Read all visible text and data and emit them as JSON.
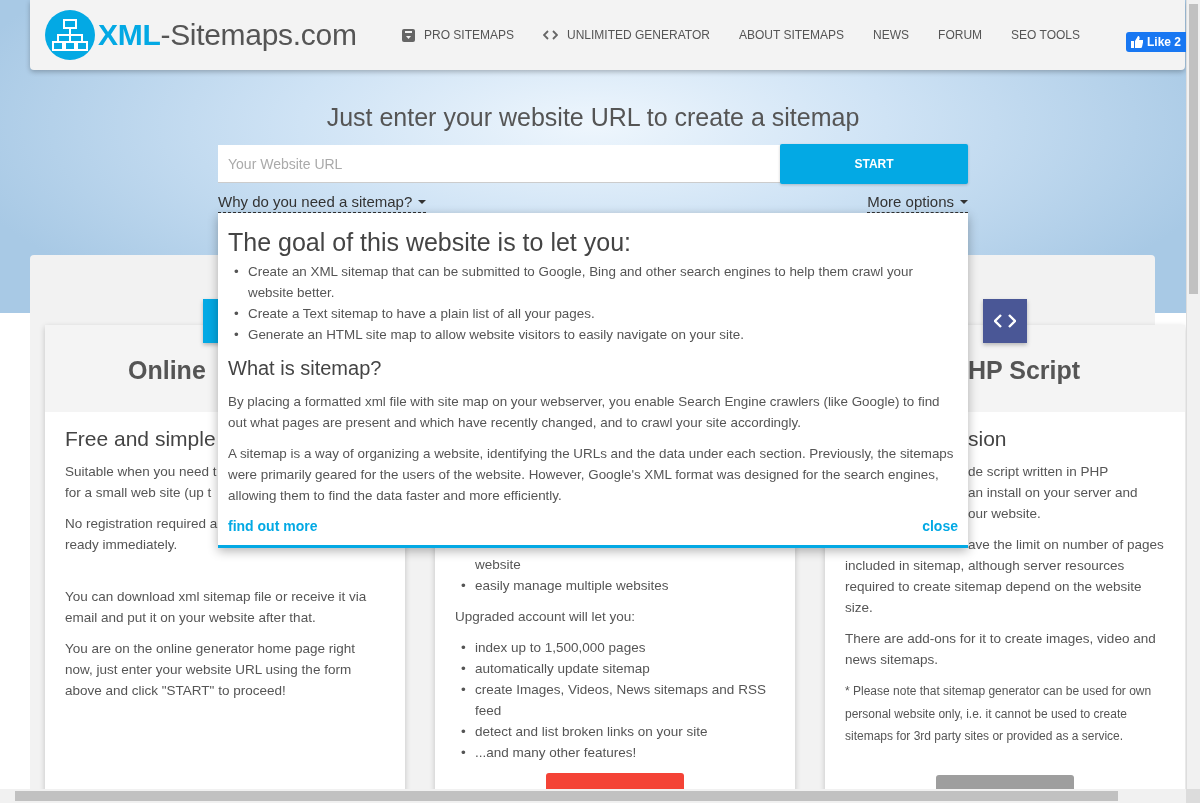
{
  "header": {
    "logo": "**XML**-Sitemaps.com",
    "nav": [
      {
        "label": "PRO SITEMAPS",
        "kind": "archive"
      },
      {
        "label": "UNLIMITED GENERATOR",
        "kind": "code"
      },
      {
        "label": "ABOUT SITEMAPS",
        "kind": "plain"
      },
      {
        "label": "NEWS",
        "kind": "plain"
      },
      {
        "label": "FORUM",
        "kind": "plain"
      },
      {
        "label": "SEO TOOLS",
        "kind": "plain"
      }
    ],
    "like_button": "Like 2"
  },
  "hero": {
    "title": "Just enter your website URL to create a sitemap",
    "url_field": {
      "placeholder": "Your Website URL"
    },
    "start_button": "START",
    "why_link": "Why do you need a sitemap?",
    "options_link": "More options"
  },
  "cards": [
    {
      "kind": "cut_right",
      "tile": {
        "color": "#03a9e4",
        "kind": "plain"
      },
      "title": "Online",
      "subtitle": "Free and simple",
      "blocks": [
        {
          "kind": "para",
          "text": "Suitable when you need t\nfor a small web site (up t"
        },
        {
          "kind": "para",
          "text": "No registration required a\nready immediately."
        },
        {
          "kind": "para",
          "text": "You can download xml sitemap file or receive it via email and put it on your website after that."
        },
        {
          "kind": "para",
          "text": "You are on the online generator home page right now, just enter your website URL using the form above and click \"START\" to proceed!"
        }
      ]
    },
    {
      "kind": "covered",
      "blocks": [
        {
          "kind": "list_cont",
          "text": "website"
        },
        {
          "kind": "list",
          "marker": "•",
          "items": [
            "easily manage multiple websites"
          ]
        },
        {
          "kind": "para",
          "text": "Upgraded account will let you:"
        },
        {
          "kind": "list",
          "marker": "•",
          "items": [
            "index up to 1,500,000 pages",
            "automatically update sitemap",
            "create Images, Videos, News sitemaps and RSS feed",
            "detect and list broken links on your site",
            "...and many other features!"
          ]
        },
        {
          "kind": "button",
          "color": "#f44336"
        }
      ]
    },
    {
      "kind": "cut_left",
      "tile": {
        "color": "#4a5796",
        "kind": "code"
      },
      "title": "HP Script",
      "subtitle": "sion",
      "blocks": [
        {
          "kind": "para_cut",
          "text": "de script written in PHP\nan install on your server and\nour website."
        },
        {
          "kind": "para_cut_first",
          "text": "ave the limit on number of pages\nincluded in sitemap, although server resources\nrequired to create sitemap depend on the website\nsize."
        },
        {
          "kind": "para",
          "text": "There are add-ons for it to create images, video and news sitemaps."
        },
        {
          "kind": "note",
          "text": "* Please note that sitemap generator can be used for own personal website only, i.e. it cannot be used to create sitemaps for 3rd party sites or provided as a service."
        },
        {
          "kind": "button",
          "color": "#9e9e9e"
        }
      ]
    }
  ],
  "popup": {
    "heading": "The goal of this website is to let you:",
    "goal_marker": "•",
    "goals": [
      "Create an XML sitemap that can be submitted to Google, Bing and other search engines to help them crawl your website better.",
      "Create a Text sitemap to have a plain list of all your pages.",
      "Generate an HTML site map to allow website visitors to easily navigate on your site."
    ],
    "subheading": "What is sitemap?",
    "paragraphs": [
      "By placing a formatted xml file with site map on your webserver, you enable Search Engine crawlers (like Google) to find out what pages are present and which have recently changed, and to crawl your site accordingly.",
      "A sitemap is a way of organizing a website, identifying the URLs and the data under each section. Previously, the sitemaps were primarily geared for the users of the website. However, Google's XML format was designed for the search engines, allowing them to find the data faster and more efficiently."
    ],
    "more_link": "find out more",
    "close_link": "close"
  }
}
